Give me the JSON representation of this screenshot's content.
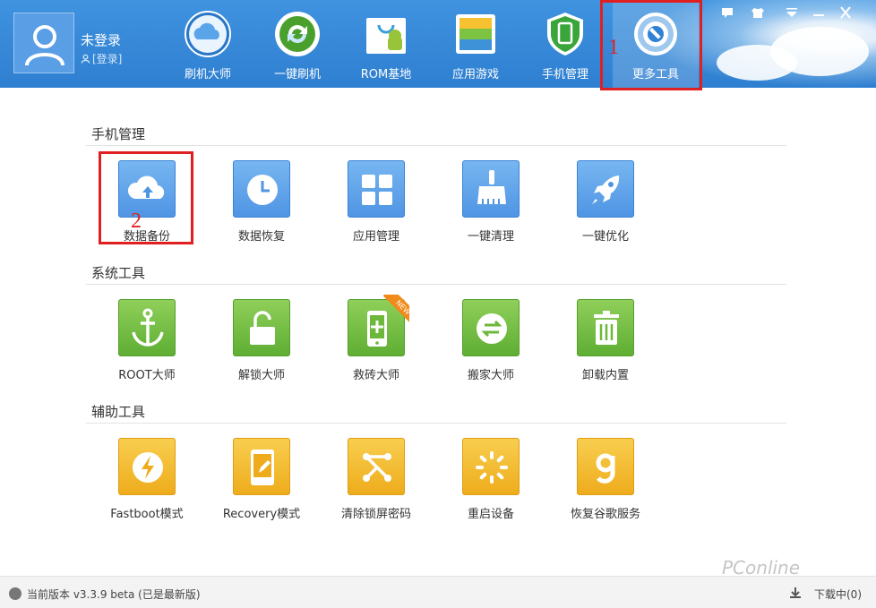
{
  "header": {
    "username": "未登录",
    "login_link": "[登录]",
    "nav": [
      {
        "label": "刷机大师",
        "icon": "cloud-icon"
      },
      {
        "label": "一键刷机",
        "icon": "refresh-icon"
      },
      {
        "label": "ROM基地",
        "icon": "android-bag-icon"
      },
      {
        "label": "应用游戏",
        "icon": "layers-icon"
      },
      {
        "label": "手机管理",
        "icon": "shield-phone-icon"
      },
      {
        "label": "更多工具",
        "icon": "gear-wrench-icon"
      }
    ],
    "active_nav": "更多工具"
  },
  "annotations": {
    "marker_1": "1",
    "marker_2": "2"
  },
  "sections": [
    {
      "title": "手机管理",
      "tools": [
        {
          "label": "数据备份",
          "icon": "cloud-upload-icon",
          "color": "#5a9ee8"
        },
        {
          "label": "数据恢复",
          "icon": "clock-icon",
          "color": "#5a9ee8"
        },
        {
          "label": "应用管理",
          "icon": "grid-icon",
          "color": "#5a9ee8"
        },
        {
          "label": "一键清理",
          "icon": "brush-icon",
          "color": "#5a9ee8"
        },
        {
          "label": "一键优化",
          "icon": "rocket-icon",
          "color": "#5a9ee8"
        }
      ]
    },
    {
      "title": "系统工具",
      "tools": [
        {
          "label": "ROOT大师",
          "icon": "anchor-icon",
          "color": "#6db83b"
        },
        {
          "label": "解锁大师",
          "icon": "unlock-icon",
          "color": "#6db83b"
        },
        {
          "label": "救砖大师",
          "icon": "phone-plus-icon",
          "color": "#6db83b",
          "badge": "NEW"
        },
        {
          "label": "搬家大师",
          "icon": "transfer-icon",
          "color": "#6db83b"
        },
        {
          "label": "卸载内置",
          "icon": "trash-icon",
          "color": "#6db83b"
        }
      ]
    },
    {
      "title": "辅助工具",
      "tools": [
        {
          "label": "Fastboot模式",
          "icon": "lightning-icon",
          "color": "#f1b526"
        },
        {
          "label": "Recovery模式",
          "icon": "phone-edit-icon",
          "color": "#f1b526"
        },
        {
          "label": "清除锁屏密码",
          "icon": "pattern-lock-icon",
          "color": "#f1b526"
        },
        {
          "label": "重启设备",
          "icon": "loading-icon",
          "color": "#f1b526"
        },
        {
          "label": "恢复谷歌服务",
          "icon": "google-g-icon",
          "color": "#f1b526"
        }
      ]
    }
  ],
  "status": {
    "version_text": "当前版本 v3.3.9 beta (已是最新版)",
    "download_text": "下载中(0)"
  },
  "watermark": "PConline"
}
